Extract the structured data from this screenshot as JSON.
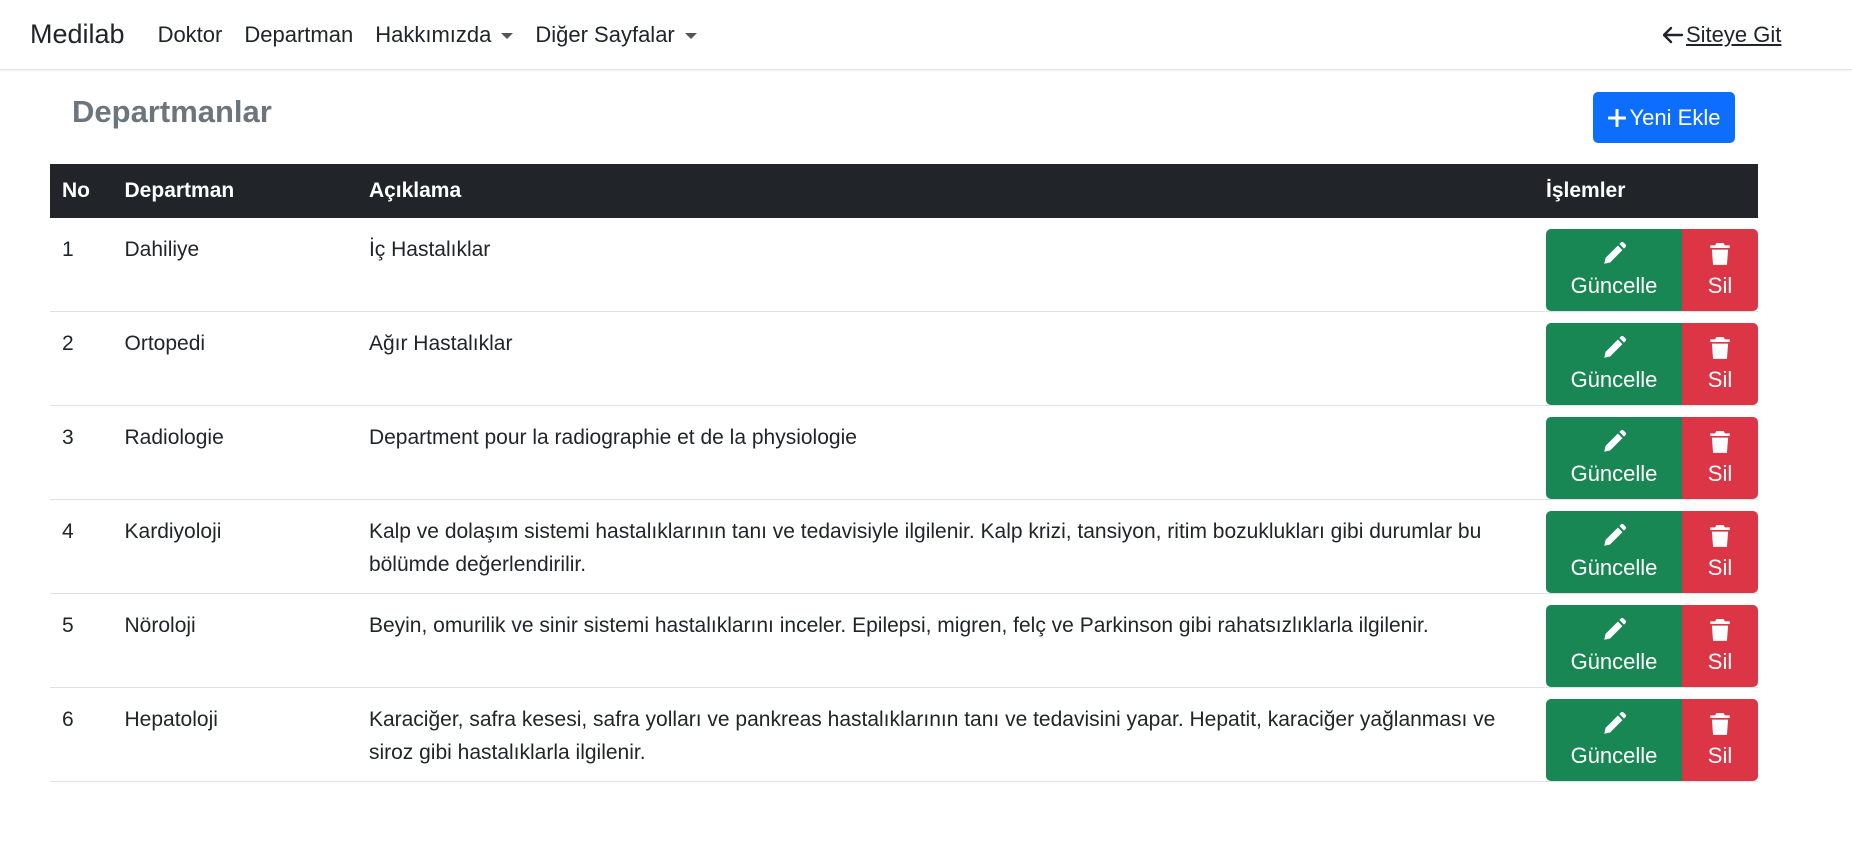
{
  "navbar": {
    "brand": "Medilab",
    "links": [
      {
        "label": "Doktor",
        "dropdown": false
      },
      {
        "label": "Departman",
        "dropdown": false
      },
      {
        "label": "Hakkımızda",
        "dropdown": true
      },
      {
        "label": "Diğer Sayfalar",
        "dropdown": true
      }
    ],
    "site_link": "Siteye Git"
  },
  "page": {
    "title": "Departmanlar",
    "add_button": "Yeni Ekle"
  },
  "table": {
    "headers": [
      "No",
      "Departman",
      "Açıklama",
      "İşlemler"
    ],
    "rows": [
      {
        "no": "1",
        "name": "Dahiliye",
        "desc": "İç Hastalıklar"
      },
      {
        "no": "2",
        "name": "Ortopedi",
        "desc": "Ağır Hastalıklar"
      },
      {
        "no": "3",
        "name": "Radiologie",
        "desc": "Department pour la radiographie et de la physiologie"
      },
      {
        "no": "4",
        "name": "Kardiyoloji",
        "desc": "Kalp ve dolaşım sistemi hastalıklarının tanı ve tedavisiyle ilgilenir. Kalp krizi, tansiyon, ritim bozuklukları gibi durumlar bu bölümde değerlendirilir."
      },
      {
        "no": "5",
        "name": "Nöroloji",
        "desc": "Beyin, omurilik ve sinir sistemi hastalıklarını inceler. Epilepsi, migren, felç ve Parkinson gibi rahatsızlıklarla ilgilenir."
      },
      {
        "no": "6",
        "name": "Hepatoloji",
        "desc": "Karaciğer, safra kesesi, safra yolları ve pankreas hastalıklarının tanı ve tedavisini yapar. Hepatit, karaciğer yağlanması ve siroz gibi hastalıklarla ilgilenir."
      }
    ],
    "update_label": "Güncelle",
    "delete_label": "Sil"
  },
  "colors": {
    "primary": "#0d6efd",
    "success": "#198754",
    "danger": "#dc3545",
    "header_dark": "#212529",
    "title_gray": "#6c757d"
  },
  "icons": [
    "arrow-left-icon",
    "plus-icon",
    "pencil-icon",
    "trash-icon",
    "caret-down-icon"
  ]
}
